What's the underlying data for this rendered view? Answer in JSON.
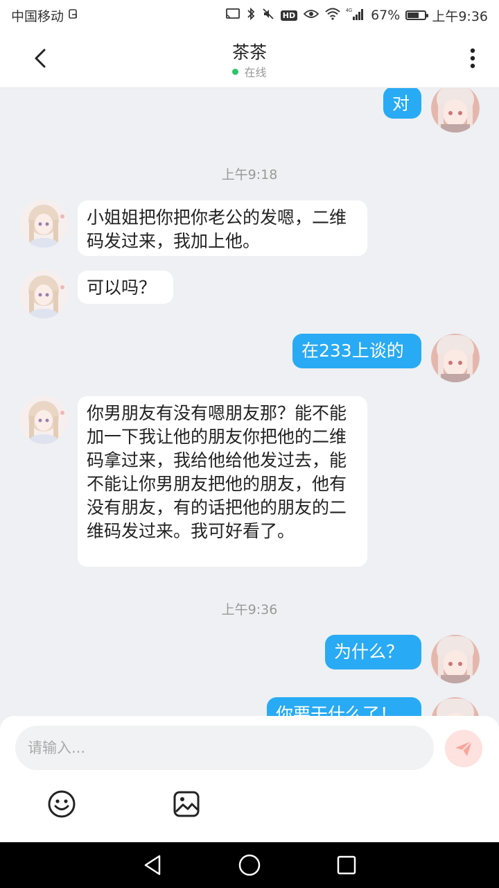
{
  "status_bar": {
    "carrier": "中国移动",
    "battery": "67%",
    "battery_level": 0.67,
    "time": "上午9:36",
    "hd": "HD",
    "network": "4G"
  },
  "header": {
    "title": "茶茶",
    "status": "在线"
  },
  "messages": {
    "m0": "对",
    "t1": "上午9:18",
    "m1": "小姐姐把你把你老公的发嗯，二维码发过来，我加上他。",
    "m2": "可以吗？",
    "m3": "在233上谈的",
    "m4": "你男朋友有没有嗯朋友那？能不能加一下我让他的朋友你把他的二维码拿过来，我给他给他发过去，能不能让你男朋友把他的朋友，他有没有朋友，有的话把他的朋友的二维码发过来。我可好看了。",
    "t2": "上午9:36",
    "m5": "为什么？",
    "m6": "你要干什么了！"
  },
  "input": {
    "placeholder": "请输入..."
  },
  "colors": {
    "outgoing_bubble": "#29aaf4",
    "incoming_bubble": "#ffffff",
    "online": "#2fc36a",
    "send_button": "#fde2df",
    "send_icon": "#f7a79c"
  },
  "icons": {
    "back": "chevron-left-icon",
    "more": "more-vertical-icon",
    "emoji": "smiley-icon",
    "image": "image-icon",
    "send": "send-plane-icon"
  }
}
